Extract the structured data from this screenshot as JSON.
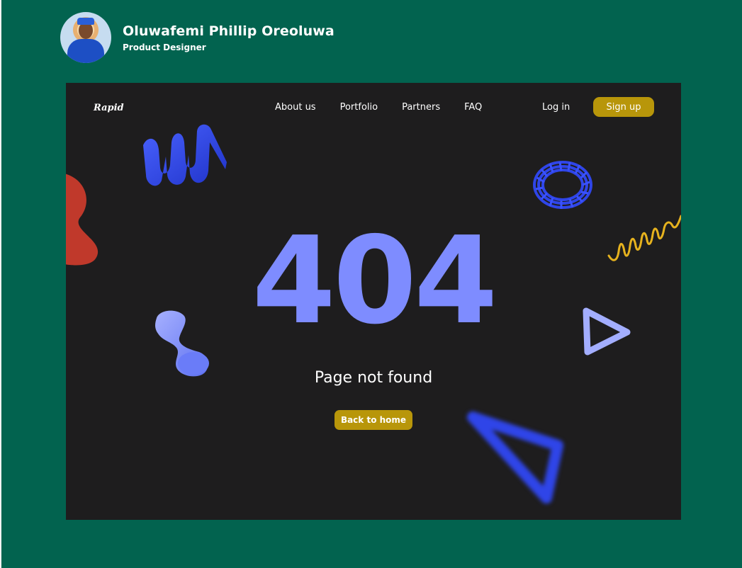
{
  "profile": {
    "name": "Oluwafemi Phillip Oreoluwa",
    "role": "Product Designer"
  },
  "site": {
    "logo": "Rapid",
    "nav": [
      "About us",
      "Portfolio",
      "Partners",
      "FAQ"
    ],
    "login_label": "Log in",
    "signup_label": "Sign up"
  },
  "error": {
    "code": "404",
    "message": "Page not found",
    "back_label": "Back to home"
  },
  "colors": {
    "background": "#02634f",
    "frame": "#1e1d1e",
    "accent": "#b8960a",
    "code_color": "#7e8cff",
    "shape_blue": "#2f45e8",
    "shape_red": "#c0392b",
    "shape_yellow": "#e6b21e"
  },
  "icons": [
    "wave-shape-3d",
    "coil-ring-3d",
    "squiggle-line",
    "hourglass-shape-3d",
    "triangle-outline-3d",
    "blurred-triangle-3d",
    "red-blob"
  ]
}
